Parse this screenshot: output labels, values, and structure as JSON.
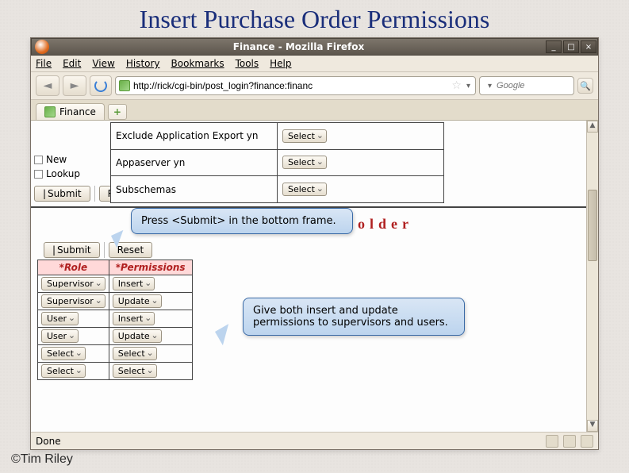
{
  "slide_title": "Insert Purchase Order Permissions",
  "copyright": "©Tim Riley",
  "window": {
    "title": "Finance - Mozilla Firefox",
    "minimize": "_",
    "maximize": "□",
    "close": "×"
  },
  "menubar": [
    "File",
    "Edit",
    "View",
    "History",
    "Bookmarks",
    "Tools",
    "Help"
  ],
  "toolbar": {
    "url": "http://rick/cgi-bin/post_login?finance:financ",
    "search_placeholder": "Google"
  },
  "tab": {
    "label": "Finance",
    "new": "+"
  },
  "topframe": {
    "left": {
      "new": "New",
      "lookup": "Lookup",
      "submit": "Submit",
      "r_btn": "R"
    },
    "rows": [
      {
        "label": "Exclude Application Export yn",
        "value": "Select"
      },
      {
        "label": "Appaserver yn",
        "value": "Select"
      },
      {
        "label": "Subschemas",
        "value": "Select"
      }
    ]
  },
  "bottomframe": {
    "title": "Insert  Role  Folder",
    "submit": "Submit",
    "reset": "Reset",
    "headers": {
      "role": "*Role",
      "permissions": "*Permissions"
    },
    "rows": [
      {
        "role": "Supervisor",
        "perm": "Insert"
      },
      {
        "role": "Supervisor",
        "perm": "Update"
      },
      {
        "role": "User",
        "perm": "Insert"
      },
      {
        "role": "User",
        "perm": "Update"
      },
      {
        "role": "Select",
        "perm": "Select"
      },
      {
        "role": "Select",
        "perm": "Select"
      }
    ]
  },
  "status": {
    "done": "Done"
  },
  "callouts": {
    "c1": "Press <Submit> in the bottom frame.",
    "c2": "Give both insert and update permissions to supervisors and users."
  }
}
